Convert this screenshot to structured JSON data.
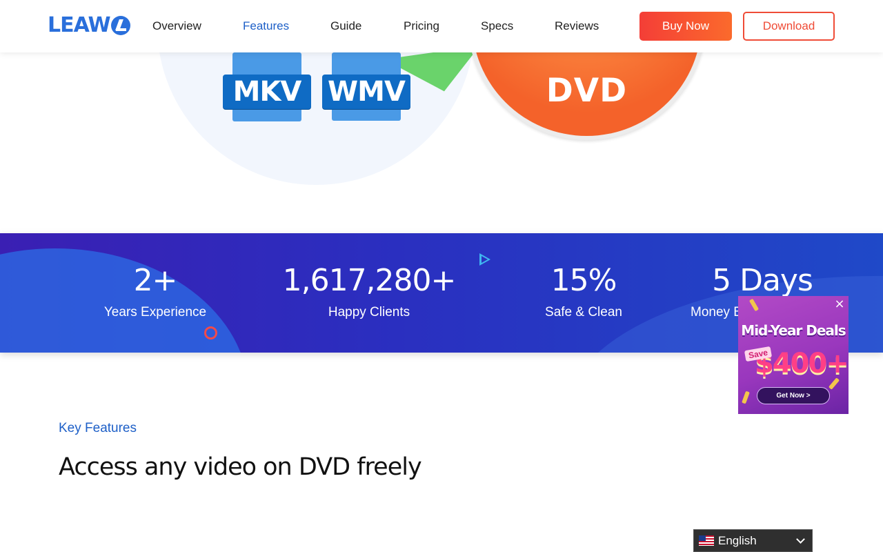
{
  "header": {
    "logo_text": "LEAW",
    "nav": [
      "Overview",
      "Features",
      "Guide",
      "Pricing",
      "Specs",
      "Reviews"
    ],
    "active_nav": "Features",
    "buy_label": "Buy Now",
    "download_label": "Download"
  },
  "hero": {
    "formats": [
      "MKV",
      "WMV"
    ],
    "disc_label": "DVD"
  },
  "stats": [
    {
      "value": "2+",
      "label": "Years Experience"
    },
    {
      "value": "1,617,280+",
      "label": "Happy Clients"
    },
    {
      "value": "15%",
      "label": "Safe & Clean"
    },
    {
      "value": "5 Days",
      "label": "Money B"
    }
  ],
  "promo": {
    "close": "×",
    "title": "Mid-Year Deals",
    "save": "Save",
    "amount": "$400+",
    "cta": "Get Now >"
  },
  "features": {
    "eyebrow": "Key Features",
    "headline": "Access any video on DVD freely"
  },
  "language": {
    "selected": "English"
  },
  "colors": {
    "brand_blue": "#2a6fdb",
    "accent_red": "#ef4b36",
    "nav_active": "#1d5fc7"
  }
}
